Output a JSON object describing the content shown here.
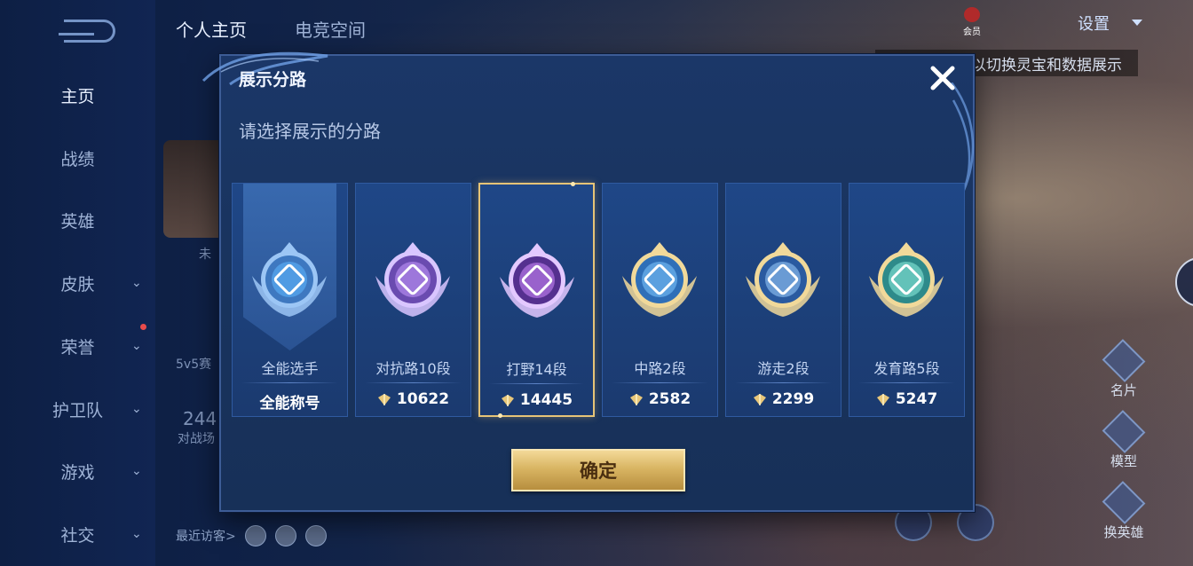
{
  "background": {
    "nav_items": [
      {
        "label": "主页",
        "active": true,
        "has_chevron": false
      },
      {
        "label": "战绩",
        "active": false,
        "has_chevron": false
      },
      {
        "label": "英雄",
        "active": false,
        "has_chevron": false
      },
      {
        "label": "皮肤",
        "active": false,
        "has_chevron": true
      },
      {
        "label": "荣誉",
        "active": false,
        "has_chevron": true
      },
      {
        "label": "护卫队",
        "active": false,
        "has_chevron": true
      },
      {
        "label": "游戏",
        "active": false,
        "has_chevron": true
      },
      {
        "label": "社交",
        "active": false,
        "has_chevron": true
      }
    ],
    "tabs": [
      "个人主页",
      "电竞空间"
    ],
    "settings_label": "设置",
    "member_label": "会员",
    "hint_text": "以切换灵宝和数据展示",
    "visitors_label": "最近访客>",
    "ghost_texts": {
      "unread": "未",
      "season": "5v5赛",
      "count": "244",
      "battle": "对战场"
    },
    "right_buttons": [
      "名片",
      "模型",
      "换英雄"
    ]
  },
  "dialog": {
    "title": "展示分路",
    "subtitle": "请选择展示的分路",
    "confirm_label": "确定",
    "accent_color": "#e6c477",
    "cards": [
      {
        "name": "全能选手",
        "score": "全能称号",
        "emblem": "all-round-emblem",
        "selected": false,
        "has_bolt": false
      },
      {
        "name": "对抗路10段",
        "score": "10622",
        "emblem": "clash-lane-emblem",
        "selected": false,
        "has_bolt": true
      },
      {
        "name": "打野14段",
        "score": "14445",
        "emblem": "jungle-emblem",
        "selected": true,
        "has_bolt": true
      },
      {
        "name": "中路2段",
        "score": "2582",
        "emblem": "mid-lane-emblem",
        "selected": false,
        "has_bolt": true
      },
      {
        "name": "游走2段",
        "score": "2299",
        "emblem": "roam-emblem",
        "selected": false,
        "has_bolt": true
      },
      {
        "name": "发育路5段",
        "score": "5247",
        "emblem": "farm-lane-emblem",
        "selected": false,
        "has_bolt": true
      }
    ]
  }
}
